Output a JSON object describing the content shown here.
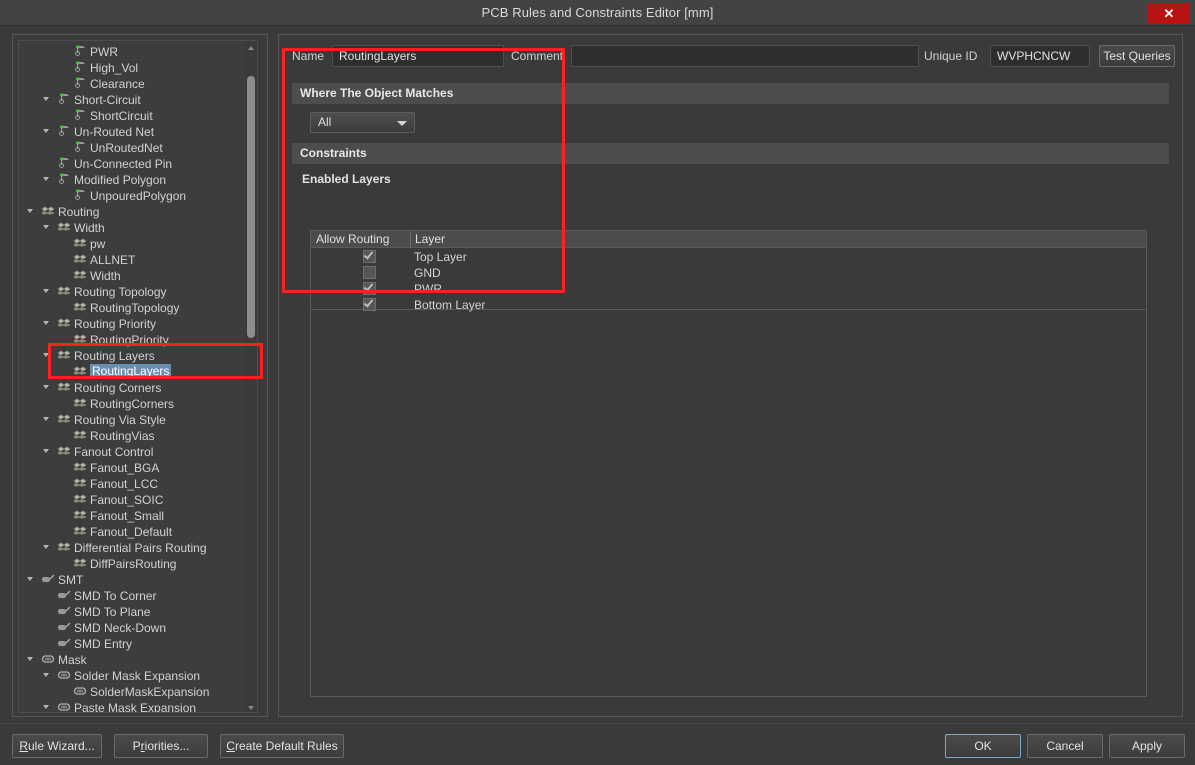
{
  "window": {
    "title": "PCB Rules and Constraints Editor [mm]",
    "close_icon": "close-icon",
    "close_label": "✕"
  },
  "tree": {
    "scrollbar": {
      "up_icon": "scroll-up-arrow-icon",
      "down_icon": "scroll-down-arrow-icon"
    },
    "items": [
      {
        "label": "PWR",
        "depth": 3,
        "icon": "net-rule-icon",
        "expander": "none"
      },
      {
        "label": "High_Vol",
        "depth": 3,
        "icon": "net-rule-icon",
        "expander": "none"
      },
      {
        "label": "Clearance",
        "depth": 3,
        "icon": "net-rule-icon",
        "expander": "none"
      },
      {
        "label": "Short-Circuit",
        "depth": 2,
        "icon": "electrical-rule-icon",
        "expander": "open"
      },
      {
        "label": "ShortCircuit",
        "depth": 3,
        "icon": "net-rule-icon",
        "expander": "none"
      },
      {
        "label": "Un-Routed Net",
        "depth": 2,
        "icon": "electrical-rule-icon",
        "expander": "open"
      },
      {
        "label": "UnRoutedNet",
        "depth": 3,
        "icon": "net-rule-icon",
        "expander": "none"
      },
      {
        "label": "Un-Connected Pin",
        "depth": 2,
        "icon": "electrical-rule-icon",
        "expander": "none"
      },
      {
        "label": "Modified Polygon",
        "depth": 2,
        "icon": "electrical-rule-icon",
        "expander": "open"
      },
      {
        "label": "UnpouredPolygon",
        "depth": 3,
        "icon": "net-rule-icon",
        "expander": "none"
      },
      {
        "label": "Routing",
        "depth": 1,
        "icon": "routing-icon",
        "expander": "open"
      },
      {
        "label": "Width",
        "depth": 2,
        "icon": "routing-icon",
        "expander": "open"
      },
      {
        "label": "pw",
        "depth": 3,
        "icon": "routing-icon",
        "expander": "none"
      },
      {
        "label": "ALLNET",
        "depth": 3,
        "icon": "routing-icon",
        "expander": "none"
      },
      {
        "label": "Width",
        "depth": 3,
        "icon": "routing-icon",
        "expander": "none"
      },
      {
        "label": "Routing Topology",
        "depth": 2,
        "icon": "routing-icon",
        "expander": "open"
      },
      {
        "label": "RoutingTopology",
        "depth": 3,
        "icon": "routing-icon",
        "expander": "none"
      },
      {
        "label": "Routing Priority",
        "depth": 2,
        "icon": "routing-icon",
        "expander": "open"
      },
      {
        "label": "RoutingPriority",
        "depth": 3,
        "icon": "routing-icon",
        "expander": "none"
      },
      {
        "label": "Routing Layers",
        "depth": 2,
        "icon": "routing-icon",
        "expander": "open"
      },
      {
        "label": "RoutingLayers",
        "depth": 3,
        "icon": "routing-icon",
        "expander": "none",
        "selected": true
      },
      {
        "label": "Routing Corners",
        "depth": 2,
        "icon": "routing-icon",
        "expander": "open"
      },
      {
        "label": "RoutingCorners",
        "depth": 3,
        "icon": "routing-icon",
        "expander": "none"
      },
      {
        "label": "Routing Via Style",
        "depth": 2,
        "icon": "routing-icon",
        "expander": "open"
      },
      {
        "label": "RoutingVias",
        "depth": 3,
        "icon": "routing-icon",
        "expander": "none"
      },
      {
        "label": "Fanout Control",
        "depth": 2,
        "icon": "routing-icon",
        "expander": "open"
      },
      {
        "label": "Fanout_BGA",
        "depth": 3,
        "icon": "routing-icon",
        "expander": "none"
      },
      {
        "label": "Fanout_LCC",
        "depth": 3,
        "icon": "routing-icon",
        "expander": "none"
      },
      {
        "label": "Fanout_SOIC",
        "depth": 3,
        "icon": "routing-icon",
        "expander": "none"
      },
      {
        "label": "Fanout_Small",
        "depth": 3,
        "icon": "routing-icon",
        "expander": "none"
      },
      {
        "label": "Fanout_Default",
        "depth": 3,
        "icon": "routing-icon",
        "expander": "none"
      },
      {
        "label": "Differential Pairs Routing",
        "depth": 2,
        "icon": "routing-icon",
        "expander": "open"
      },
      {
        "label": "DiffPairsRouting",
        "depth": 3,
        "icon": "routing-icon",
        "expander": "none"
      },
      {
        "label": "SMT",
        "depth": 1,
        "icon": "smt-icon",
        "expander": "open"
      },
      {
        "label": "SMD To Corner",
        "depth": 2,
        "icon": "smt-icon",
        "expander": "none"
      },
      {
        "label": "SMD To Plane",
        "depth": 2,
        "icon": "smt-icon",
        "expander": "none"
      },
      {
        "label": "SMD Neck-Down",
        "depth": 2,
        "icon": "smt-icon",
        "expander": "none"
      },
      {
        "label": "SMD Entry",
        "depth": 2,
        "icon": "smt-icon",
        "expander": "none"
      },
      {
        "label": "Mask",
        "depth": 1,
        "icon": "mask-icon",
        "expander": "open"
      },
      {
        "label": "Solder Mask Expansion",
        "depth": 2,
        "icon": "mask-icon",
        "expander": "open"
      },
      {
        "label": "SolderMaskExpansion",
        "depth": 3,
        "icon": "mask-icon",
        "expander": "none"
      },
      {
        "label": "Paste Mask Expansion",
        "depth": 2,
        "icon": "mask-icon",
        "expander": "open"
      }
    ]
  },
  "form": {
    "name_label": "Name",
    "name_value": "RoutingLayers",
    "comment_label": "Comment",
    "comment_value": "",
    "unique_id_label": "Unique ID",
    "unique_id_value": "WVPHCNCW",
    "test_queries_label": "Test Queries",
    "where_header": "Where The Object Matches",
    "scope_value": "All",
    "scope_arrow_icon": "chevron-down-icon",
    "constraints_header": "Constraints",
    "enabled_layers_header": "Enabled Layers"
  },
  "layers_table": {
    "columns": [
      "Allow Routing",
      "Layer"
    ],
    "rows": [
      {
        "allow_routing": true,
        "layer": "Top Layer"
      },
      {
        "allow_routing": false,
        "layer": "GND"
      },
      {
        "allow_routing": true,
        "layer": "PWR"
      },
      {
        "allow_routing": true,
        "layer": "Bottom Layer"
      }
    ]
  },
  "footer": {
    "left_buttons": [
      {
        "label": "Rule Wizard...",
        "mnemonic": "R",
        "name": "rule-wizard-button"
      },
      {
        "label": "Priorities...",
        "mnemonic": "r",
        "name": "priorities-button"
      },
      {
        "label": "Create Default Rules",
        "mnemonic": "C",
        "name": "create-default-rules-button"
      }
    ],
    "right_buttons": [
      {
        "label": "OK",
        "name": "ok-button"
      },
      {
        "label": "Cancel",
        "name": "cancel-button"
      },
      {
        "label": "Apply",
        "name": "apply-button"
      }
    ]
  },
  "annotations": {
    "tree_highlight": "red-highlight-box-tree",
    "form_highlight": "red-highlight-box-form",
    "color": "#ff2020"
  }
}
